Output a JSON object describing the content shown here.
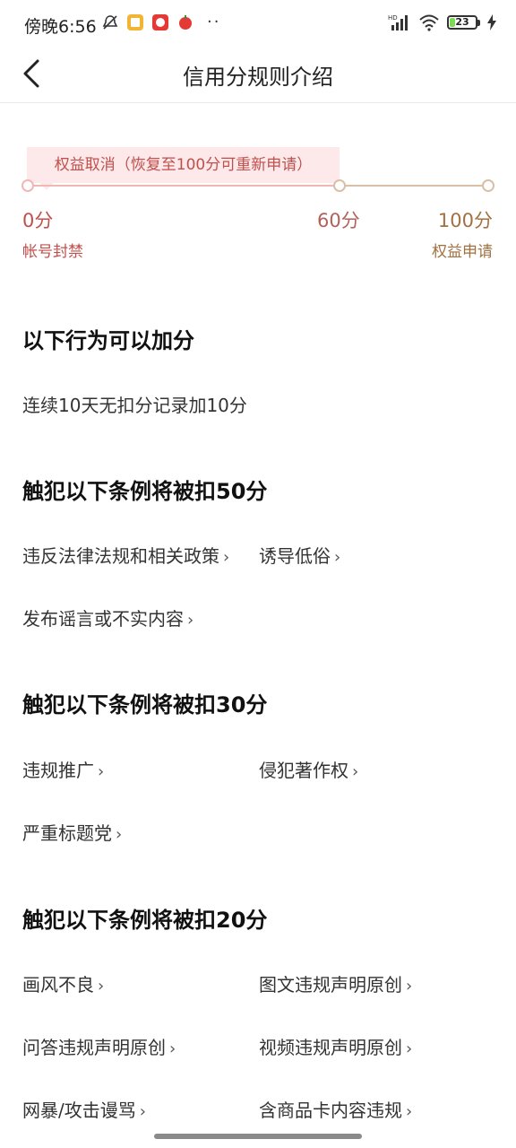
{
  "status_bar": {
    "time": "傍晚6:56",
    "dots": "··",
    "battery_level": "23",
    "battery_percent": 23
  },
  "nav": {
    "title": "信用分规则介绍"
  },
  "scale": {
    "tip": "权益取消（恢复至100分可重新申请）",
    "labels": [
      "0分",
      "60分",
      "100分"
    ],
    "caption_left": "帐号封禁",
    "caption_right": "权益申请",
    "colors": {
      "red": "#c0504d",
      "tan": "#a3703f",
      "tip_bg": "#fde9e9"
    }
  },
  "sections": [
    {
      "title": "以下行为可以加分",
      "items": [
        "连续10天无扣分记录加10分"
      ]
    },
    {
      "title": "触犯以下条例将被扣50分",
      "items": [
        "违反法律法规和相关政策",
        "诱导低俗",
        "发布谣言或不实内容"
      ]
    },
    {
      "title": "触犯以下条例将被扣30分",
      "items": [
        "违规推广",
        "侵犯著作权",
        "严重标题党"
      ]
    },
    {
      "title": "触犯以下条例将被扣20分",
      "items": [
        "画风不良",
        "图文违规声明原创",
        "问答违规声明原创",
        "视频违规声明原创",
        "网暴/攻击谩骂",
        "含商品卡内容违规"
      ]
    }
  ],
  "chevron": "›"
}
